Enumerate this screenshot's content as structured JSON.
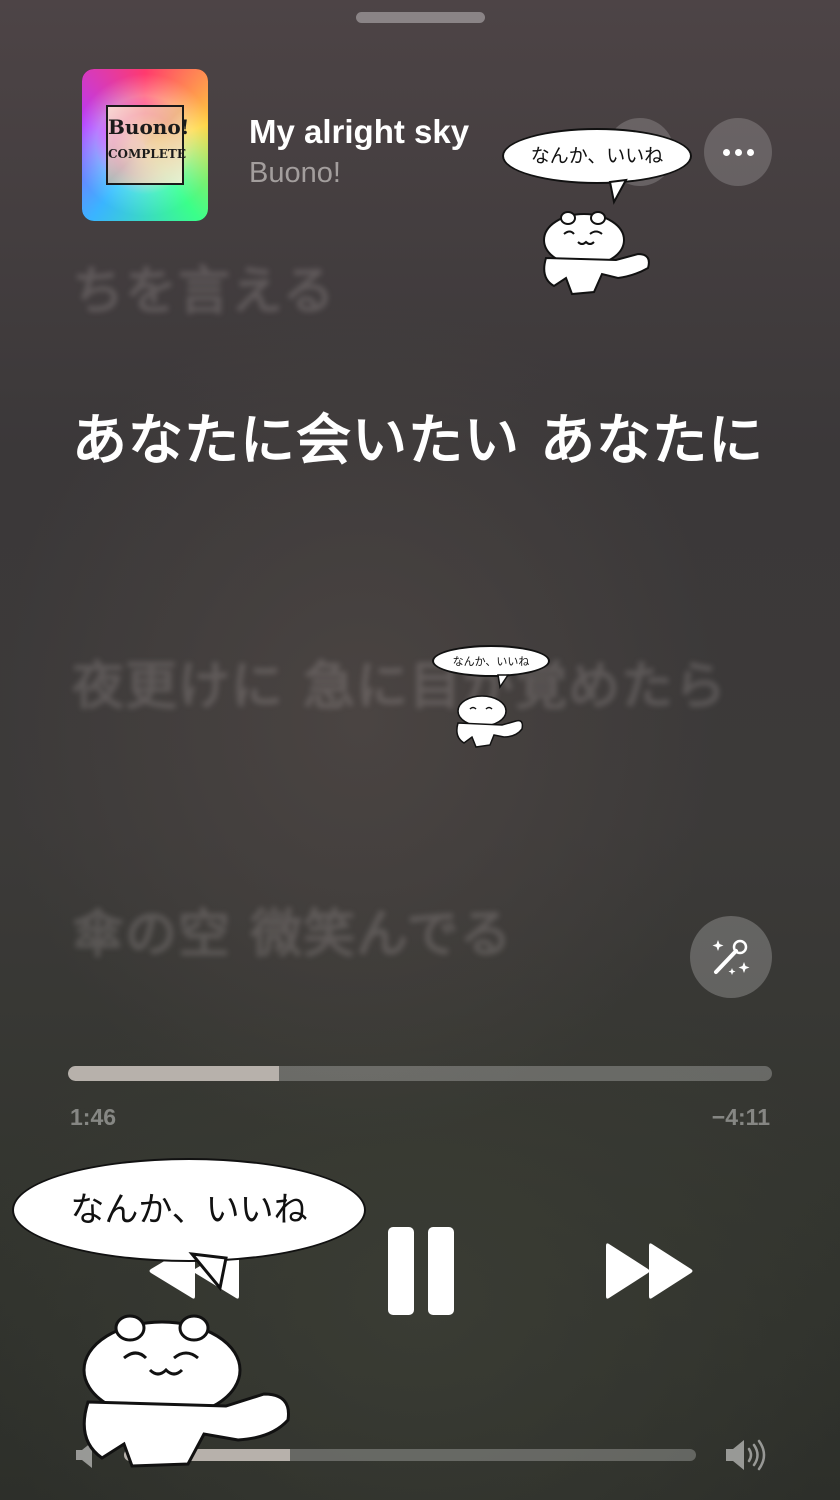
{
  "now_playing": {
    "title": "My alright sky",
    "artist": "Buono!",
    "artwork": {
      "title": "Buono!",
      "subtitle": "COMPLETE"
    }
  },
  "lyrics": [
    {
      "text": "ちを言える",
      "state": "past"
    },
    {
      "text": "あなたに会いたい あなたに",
      "state": "current"
    },
    {
      "text": "夜更けに 急に目が覚めたら",
      "state": "upcoming"
    },
    {
      "text": "傘の空 微笑んでる",
      "state": "upcoming"
    }
  ],
  "playback": {
    "elapsed": "1:46",
    "remaining": "−4:11",
    "progress_fraction": 0.3,
    "volume_fraction": 0.29
  },
  "stickers": {
    "caption": "なんか、いいね"
  },
  "icons": {
    "more": "ellipsis-icon",
    "star": "star-icon",
    "karaoke": "microphone-sparkles-icon",
    "rewind": "rewind-icon",
    "pause": "pause-icon",
    "forward": "fast-forward-icon",
    "volume_low": "speaker-low-icon",
    "volume_high": "speaker-high-icon"
  },
  "colors": {
    "primary_text": "#ffffff",
    "secondary_text": "#a39e9d",
    "progress_fill": "#b7b1ab"
  }
}
